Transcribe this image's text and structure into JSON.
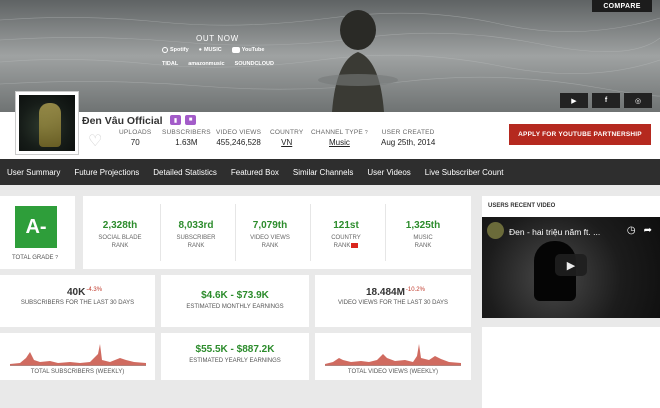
{
  "banner": {
    "compare_label": "COMPARE",
    "out_now": "OUT NOW",
    "services_row1": [
      "Spotify",
      "MUSIC",
      "YouTube"
    ],
    "services_row2": [
      "TIDAL",
      "amazonmusic",
      "SOUNDCLOUD"
    ],
    "social": [
      "youtube-icon",
      "facebook-icon",
      "instagram-icon"
    ]
  },
  "channel": {
    "name": "Đen Vâu Official",
    "stats": [
      {
        "label": "UPLOADS",
        "value": "70"
      },
      {
        "label": "SUBSCRIBERS",
        "value": "1.63M"
      },
      {
        "label": "VIDEO VIEWS",
        "value": "455,246,528"
      },
      {
        "label": "COUNTRY",
        "value": "VN"
      },
      {
        "label": "CHANNEL TYPE",
        "value": "Music"
      },
      {
        "label": "USER CREATED",
        "value": "Aug 25th, 2014"
      }
    ],
    "partner_button": "APPLY FOR YOUTUBE PARTNERSHIP"
  },
  "nav": [
    "User Summary",
    "Future Projections",
    "Detailed Statistics",
    "Featured Box",
    "Similar Channels",
    "User Videos",
    "Live Subscriber Count"
  ],
  "grade": {
    "value": "A-",
    "label": "TOTAL GRADE"
  },
  "ranks": [
    {
      "value": "2,328th",
      "line1": "SOCIAL BLADE",
      "line2": "RANK"
    },
    {
      "value": "8,033rd",
      "line1": "SUBSCRIBER",
      "line2": "RANK"
    },
    {
      "value": "7,079th",
      "line1": "VIDEO VIEWS",
      "line2": "RANK"
    },
    {
      "value": "121st",
      "line1": "COUNTRY",
      "line2": "RANK"
    },
    {
      "value": "1,325th",
      "line1": "MUSIC",
      "line2": "RANK"
    }
  ],
  "metrics": {
    "subs30": {
      "value": "40K",
      "change": "-4.3%",
      "label": "SUBSCRIBERS FOR THE LAST 30 DAYS"
    },
    "monthly": {
      "value": "$4.6K - $73.9K",
      "label": "ESTIMATED MONTHLY EARNINGS"
    },
    "views30": {
      "value": "18.484M",
      "change": "-10.2%",
      "label": "VIDEO VIEWS FOR THE LAST 30 DAYS"
    },
    "yearly": {
      "value": "$55.5K - $887.2K",
      "label": "ESTIMATED YEARLY EARNINGS"
    },
    "subs_weekly": {
      "label": "TOTAL SUBSCRIBERS (WEEKLY)"
    },
    "views_weekly": {
      "label": "TOTAL VIDEO VIEWS (WEEKLY)"
    }
  },
  "video": {
    "heading": "USERS RECENT VIDEO",
    "title": "Đen - hai triệu năm ft. ..."
  },
  "colors": {
    "accent_red": "#b5291f",
    "grade_green": "#2e9e3a",
    "rank_green": "#2c8c2c",
    "nav_bg": "#2e2e2e",
    "spark": "#c0392b"
  }
}
